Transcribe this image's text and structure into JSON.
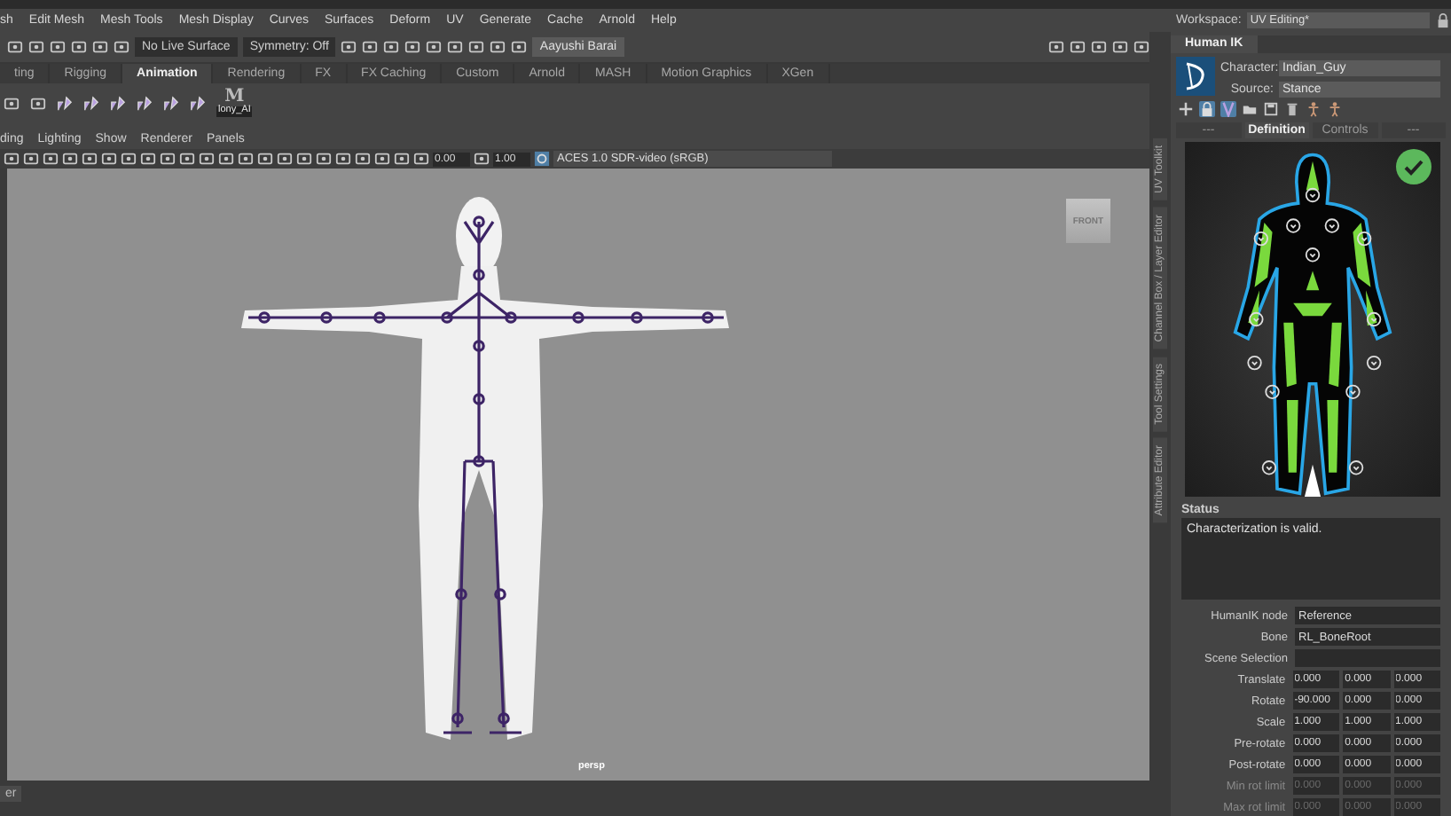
{
  "menu_bar": {
    "items": [
      "sh",
      "Edit Mesh",
      "Mesh Tools",
      "Mesh Display",
      "Curves",
      "Surfaces",
      "Deform",
      "UV",
      "Generate",
      "Cache",
      "Arnold",
      "Help"
    ]
  },
  "workspace": {
    "label": "Workspace:",
    "value": "UV Editing*"
  },
  "status_line": {
    "live_surface": "No Live Surface",
    "symmetry": "Symmetry: Off",
    "user": "Aayushi Barai"
  },
  "shelf_tabs": [
    {
      "label": "ting",
      "selected": false
    },
    {
      "label": "Rigging",
      "selected": false
    },
    {
      "label": "Animation",
      "selected": true
    },
    {
      "label": "Rendering",
      "selected": false
    },
    {
      "label": "FX",
      "selected": false
    },
    {
      "label": "FX Caching",
      "selected": false
    },
    {
      "label": "Custom",
      "selected": false
    },
    {
      "label": "Arnold",
      "selected": false
    },
    {
      "label": "MASH",
      "selected": false
    },
    {
      "label": "Motion Graphics",
      "selected": false
    },
    {
      "label": "XGen",
      "selected": false
    }
  ],
  "shelf": {
    "logo_letter": "M",
    "item_label": "lony_AI"
  },
  "panel_menu": {
    "items": [
      "ding",
      "Lighting",
      "Show",
      "Renderer",
      "Panels"
    ]
  },
  "viewport_toolbar": {
    "exposure": "0.00",
    "gamma": "1.00",
    "color_space": "ACES 1.0 SDR-video (sRGB)"
  },
  "viewport": {
    "view_cube": "FRONT",
    "camera": "persp"
  },
  "side_tabs": [
    "UV Toolkit",
    "Channel Box / Layer Editor",
    "Tool Settings",
    "Attribute Editor"
  ],
  "human_ik": {
    "tab": "Human IK",
    "character_label": "Character:",
    "character": "Indian_Guy",
    "source_label": "Source:",
    "source": "Stance",
    "tabs": [
      {
        "label": "---",
        "selected": false
      },
      {
        "label": "Definition",
        "selected": true
      },
      {
        "label": "Controls",
        "selected": false
      },
      {
        "label": "---",
        "selected": false
      }
    ],
    "valid": true,
    "status_label": "Status",
    "status_text": "Characterization is valid.",
    "fields": [
      {
        "label": "HumanIK node",
        "value": "Reference"
      },
      {
        "label": "Bone",
        "value": "RL_BoneRoot"
      },
      {
        "label": "Scene Selection"
      }
    ],
    "transforms": [
      {
        "label": "Translate",
        "values": [
          "0.000",
          "0.000",
          "0.000"
        ],
        "disabled": false
      },
      {
        "label": "Rotate",
        "values": [
          "-90.000",
          "0.000",
          "0.000"
        ],
        "disabled": false
      },
      {
        "label": "Scale",
        "values": [
          "1.000",
          "1.000",
          "1.000"
        ],
        "disabled": false
      },
      {
        "label": "Pre-rotate",
        "values": [
          "0.000",
          "0.000",
          "0.000"
        ],
        "disabled": false
      },
      {
        "label": "Post-rotate",
        "values": [
          "0.000",
          "0.000",
          "0.000"
        ],
        "disabled": false
      },
      {
        "label": "Min rot limit",
        "values": [
          "0.000",
          "0.000",
          "0.000"
        ],
        "disabled": true
      },
      {
        "label": "Max rot limit",
        "values": [
          "0.000",
          "0.000",
          "0.000"
        ],
        "disabled": true
      }
    ]
  },
  "bottom_bar": {
    "tab": "er"
  }
}
